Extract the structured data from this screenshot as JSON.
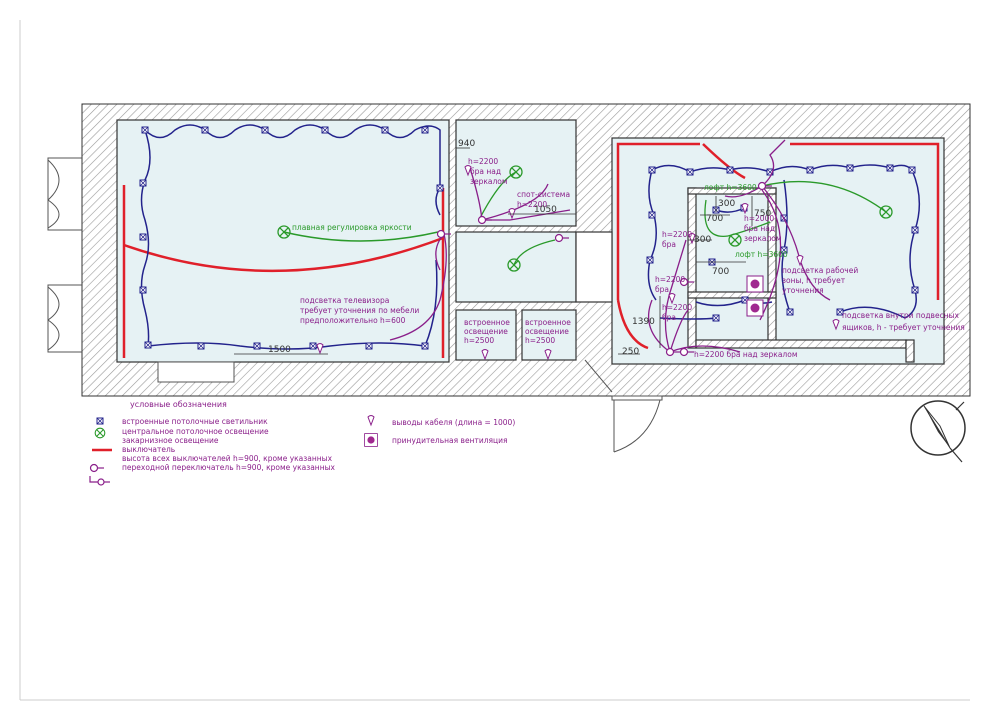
{
  "labels": {
    "brightness": "плавная регулировка яркости",
    "tv_line1": "подсветка телевизора",
    "tv_line2": "требует уточнения по мебели",
    "tv_line3": "предположительно h=600",
    "h2200_1": "h=2200",
    "bra_mirror_1": "бра над",
    "bra_mirror_2": "зеркалом",
    "spot_1": "спот-система",
    "spot_2": "h=2200",
    "builtin1_1": "встроенное",
    "builtin1_2": "освещение",
    "builtin1_3": "h=2500",
    "builtin2_1": "встроенное",
    "builtin2_2": "освещение",
    "builtin2_3": "h=2500",
    "loft1": "лофт h=3600",
    "h2000": "h=2000",
    "bra2_1": "бра над",
    "bra2_2": "зеркалом",
    "h2200_bra_1": "h=2200",
    "h2200_bra_2": "бра",
    "loft2": "лофт h=3600",
    "work_1": "подсветка рабочей",
    "work_2": "зоны, h требует",
    "work_3": "уточнения",
    "h2200_bra3_1": "h=2200",
    "h2200_bra3_2": "бра",
    "h2200_bra4_1": "h=2200",
    "h2200_bra4_2": "бра",
    "drawers_1": "подсветка внутри подвесных",
    "drawers_2": "ящиков, h - требует уточнения",
    "bra_bottom": "h=2200 бра над зеркалом"
  },
  "dimensions": {
    "d940": "940",
    "d1050": "1050",
    "d1500": "1500",
    "d300a": "300",
    "d700a": "700",
    "d750": "750",
    "d300b": "300",
    "d700b": "700",
    "d1390": "1390",
    "d250": "250"
  },
  "legend": {
    "title": "условные обозначения",
    "items": [
      "встроенные потолочные светильник",
      "центральное потолочное освещение",
      "закарнизное освещение",
      "выключатель",
      "высота всех выключателей h=900, кроме указанных",
      "переходной переключатель h=900, кроме указанных"
    ],
    "cable": "выводы кабеля (длина = 1000)",
    "vent": "принудительная вентиляция"
  },
  "colors": {
    "blue_wiring": "#23238c",
    "green_wiring": "#2a9a2a",
    "purple_wiring": "#8a1f8a",
    "cornice_red": "#e0202a",
    "room_fill": "#e6f2f4",
    "wall_hatch": "#9a9a9a"
  }
}
